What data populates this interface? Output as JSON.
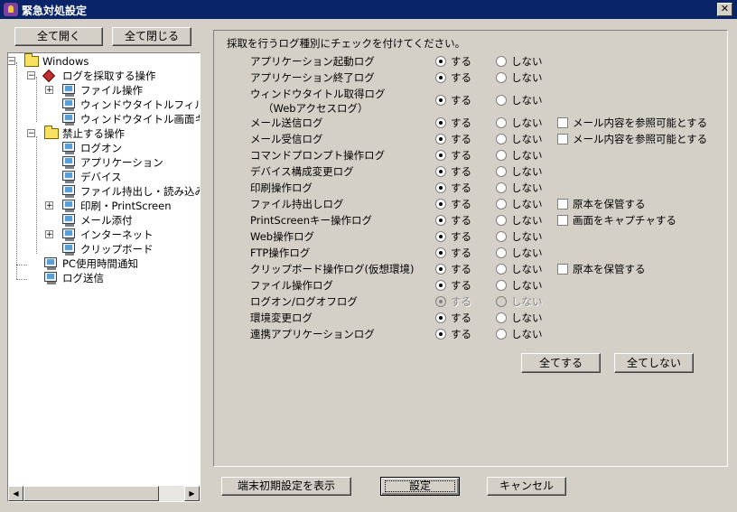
{
  "window": {
    "title": "緊急対処設定",
    "close_glyph": "✕"
  },
  "tree_buttons": {
    "expand_all": "全て開く",
    "collapse_all": "全て閉じる"
  },
  "tree": {
    "root": "Windows",
    "log_group": "ログを採取する操作",
    "log_items": [
      "ファイル操作",
      "ウィンドウタイトルフィルタ",
      "ウィンドウタイトル画面キャ"
    ],
    "prohibit_group": "禁止する操作",
    "prohibit_items": [
      "ログオン",
      "アプリケーション",
      "デバイス",
      "ファイル持出し・読み込み",
      "印刷・PrintScreen",
      "メール添付",
      "インターネット",
      "クリップボード"
    ],
    "pc_usage": "PC使用時間通知",
    "log_send": "ログ送信",
    "expander_plus": "+",
    "expander_minus": "−"
  },
  "panel": {
    "instruction": "採取を行うログ種別にチェックを付けてください。",
    "yes_label": "する",
    "no_label": "しない",
    "rows": [
      {
        "label": "アプリケーション起動ログ",
        "value": "yes"
      },
      {
        "label": "アプリケーション終了ログ",
        "value": "yes"
      },
      {
        "label": "ウィンドウタイトル取得ログ",
        "label2": "（Webアクセスログ）",
        "value": "yes"
      },
      {
        "label": "メール送信ログ",
        "value": "yes",
        "option": "メール内容を参照可能とする"
      },
      {
        "label": "メール受信ログ",
        "value": "yes",
        "option": "メール内容を参照可能とする"
      },
      {
        "label": "コマンドプロンプト操作ログ",
        "value": "yes"
      },
      {
        "label": "デバイス構成変更ログ",
        "value": "yes"
      },
      {
        "label": "印刷操作ログ",
        "value": "yes"
      },
      {
        "label": "ファイル持出しログ",
        "value": "yes",
        "option": "原本を保管する"
      },
      {
        "label": "PrintScreenキー操作ログ",
        "value": "yes",
        "option": "画面をキャプチャする"
      },
      {
        "label": "Web操作ログ",
        "value": "yes"
      },
      {
        "label": "FTP操作ログ",
        "value": "yes"
      },
      {
        "label": "クリップボード操作ログ(仮想環境)",
        "value": "yes",
        "option": "原本を保管する"
      },
      {
        "label": "ファイル操作ログ",
        "value": "yes"
      },
      {
        "label": "ログオン/ログオフログ",
        "value": "yes",
        "disabled": true
      },
      {
        "label": "環境変更ログ",
        "value": "yes"
      },
      {
        "label": "連携アプリケーションログ",
        "value": "yes"
      }
    ],
    "all_yes": "全てする",
    "all_no": "全てしない"
  },
  "bottom": {
    "defaults": "端末初期設定を表示",
    "set": "設定",
    "cancel": "キャンセル"
  },
  "colors": {
    "titlebar": "#0a246a",
    "face": "#d4d0c8"
  }
}
